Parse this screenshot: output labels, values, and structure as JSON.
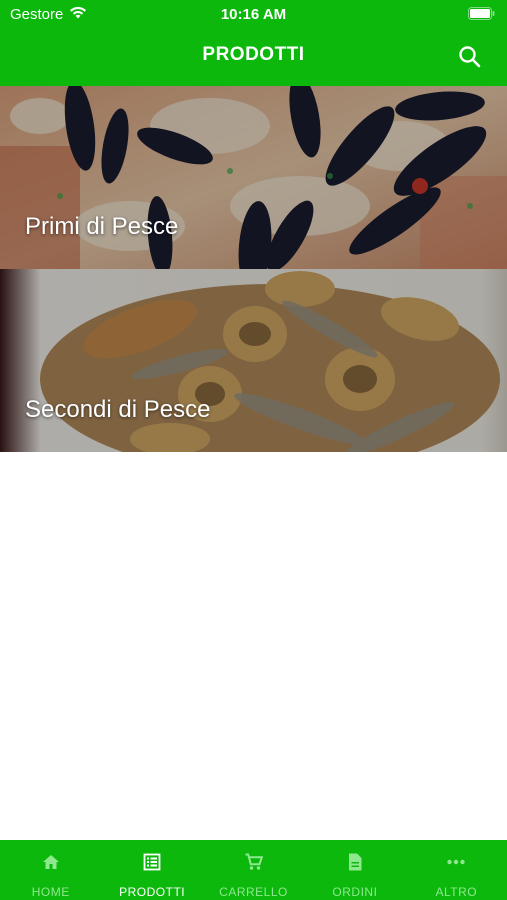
{
  "status_bar": {
    "carrier": "Gestore",
    "time": "10:16 AM"
  },
  "header": {
    "title": "PRODOTTI",
    "search_icon": "search-icon"
  },
  "categories": [
    {
      "label": "Primi di Pesce"
    },
    {
      "label": "Secondi di Pesce"
    }
  ],
  "tabbar": {
    "tabs": [
      {
        "label": "HOME",
        "icon": "home-icon",
        "active": false
      },
      {
        "label": "PRODOTTI",
        "icon": "list-icon",
        "active": true
      },
      {
        "label": "CARRELLO",
        "icon": "cart-icon",
        "active": false
      },
      {
        "label": "ORDINI",
        "icon": "document-icon",
        "active": false
      },
      {
        "label": "ALTRO",
        "icon": "more-icon",
        "active": false
      }
    ]
  },
  "colors": {
    "brand_green": "#0cb80c",
    "tab_inactive": "#8ee88e",
    "tab_active": "#ffffff"
  }
}
